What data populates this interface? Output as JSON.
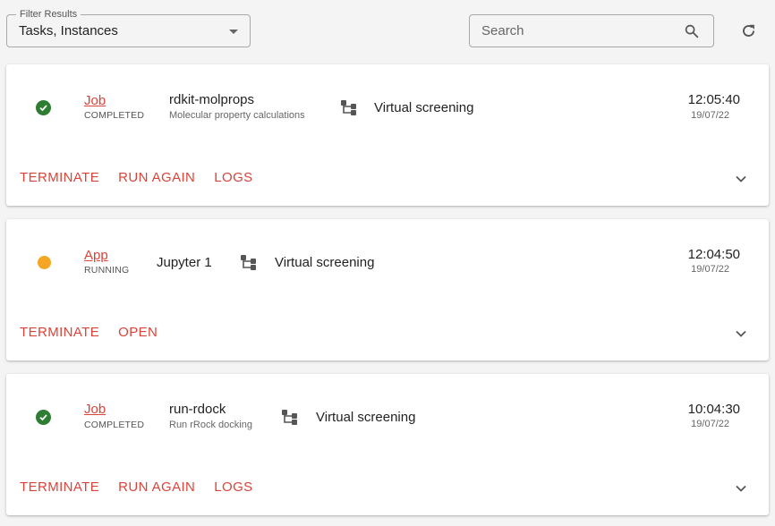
{
  "toolbar": {
    "filter_label": "Filter Results",
    "filter_value": "Tasks, Instances",
    "search_placeholder": "Search"
  },
  "colors": {
    "accent": "#d9443a",
    "completed": "#2e7d32",
    "running": "#f5a623"
  },
  "items": [
    {
      "kind": "Job",
      "state": "COMPLETED",
      "name": "rdkit-molprops",
      "description": "Molecular property calculations",
      "project": "Virtual screening",
      "time": "12:05:40",
      "date": "19/07/22",
      "actions": [
        "TERMINATE",
        "RUN AGAIN",
        "LOGS"
      ]
    },
    {
      "kind": "App",
      "state": "RUNNING",
      "name": "Jupyter 1",
      "description": "",
      "project": "Virtual screening",
      "time": "12:04:50",
      "date": "19/07/22",
      "actions": [
        "TERMINATE",
        "OPEN"
      ]
    },
    {
      "kind": "Job",
      "state": "COMPLETED",
      "name": "run-rdock",
      "description": "Run rRock docking",
      "project": "Virtual screening",
      "time": "10:04:30",
      "date": "19/07/22",
      "actions": [
        "TERMINATE",
        "RUN AGAIN",
        "LOGS"
      ]
    }
  ]
}
